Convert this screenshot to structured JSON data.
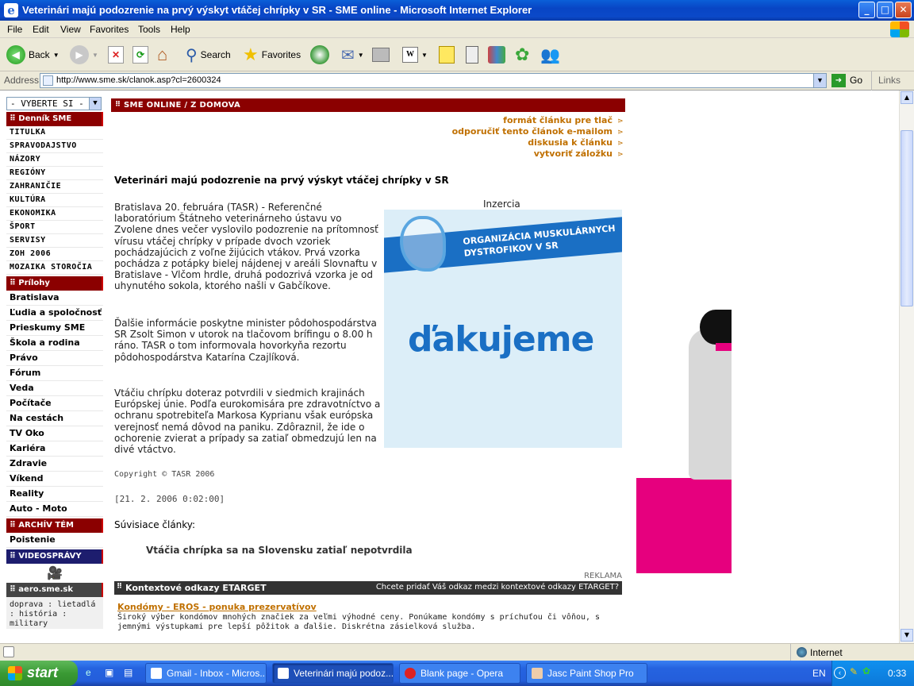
{
  "window": {
    "title": "Veterinári majú podozrenie na prvý výskyt vtáčej chrípky v SR - SME online - Microsoft Internet Explorer"
  },
  "menu": [
    "File",
    "Edit",
    "View",
    "Favorites",
    "Tools",
    "Help"
  ],
  "toolbar": {
    "back": "Back",
    "search": "Search",
    "favorites": "Favorites"
  },
  "address": {
    "label": "Address",
    "url": "http://www.sme.sk/clanok.asp?cl=2600324",
    "go": "Go",
    "links": "Links"
  },
  "nav": {
    "select": "- VYBERTE SI -",
    "sec1": "Denník SME",
    "items1": [
      "TITULKA",
      "SPRAVODAJSTVO",
      "NÁZORY",
      "REGIÓNY",
      "ZAHRANIČIE",
      "KULTÚRA",
      "EKONOMIKA",
      "ŠPORT",
      "SERVISY",
      "ZOH 2006",
      "MOZAIKA STOROČIA"
    ],
    "sec2": "Prílohy",
    "items2": [
      "Bratislava",
      "Ľudia a spoločnosť",
      "Prieskumy SME",
      "Škola a rodina",
      "Právo",
      "Fórum",
      "Veda",
      "Počítače",
      "Na cestách",
      "TV Oko",
      "Kariéra",
      "Zdravie",
      "Víkend",
      "Reality",
      "Auto - Moto"
    ],
    "sec3": "ARCHÍV TÉM",
    "item3": "Poistenie",
    "sec4": "VIDEOSPRÁVY",
    "sec5": "aero.sme.sk",
    "aero": "doprava : lietadlá : história : military"
  },
  "article": {
    "breadcrumb": "SME ONLINE / Z DOMOVA",
    "tools": [
      "formát článku pre tlač",
      "odporučiť tento článok e-mailom",
      "diskusia k článku",
      "vytvoriť záložku"
    ],
    "title": "Veterinári majú podozrenie na prvý výskyt vtáčej chrípky v SR",
    "p1": "Bratislava 20. februára (TASR) - Referenčné laboratórium Štátneho veterinárneho ústavu vo Zvolene dnes večer vyslovilo podozrenie na prítomnosť vírusu vtáčej chrípky v prípade dvoch vzoriek pochádzajúcich z voľne žijúcich vtákov. Prvá vzorka pochádza z potápky bielej nájdenej v areáli Slovnaftu v Bratislave - Vlčom hrdle, druhá podozrivá vzorka je od uhynutého sokola, ktorého našli v Gabčíkove.",
    "p2": "Ďalšie informácie poskytne minister pôdohospodárstva SR Zsolt Simon v utorok na tlačovom brífingu o 8.00 h ráno. TASR o tom informovala hovorkyňa rezortu pôdohospodárstva Katarína Czajlíková.",
    "p3": "Vtáčiu chrípku doteraz potvrdili v siedmich krajinách Európskej únie. Podľa eurokomisára pre zdravotníctvo a ochranu spotrebiteľa Markosa Kyprianu však európska verejnosť nemá dôvod na paniku. Zdôraznil, že ide o ochorenie zvierat a prípady sa zatiaľ obmedzujú len na divé vtáctvo.",
    "copyright": "Copyright © TASR 2006",
    "date": "[21. 2. 2006 0:02:00]",
    "related_label": "Súvisiace články:",
    "related": "Vtáčia chrípka sa na Slovensku zatiaľ nepotvrdila"
  },
  "ad": {
    "label": "Inzercia",
    "org": "ORGANIZÁCIA MUSKULÁRNYCH DYSTROFIKOV V SR",
    "thanks": "ďakujeme"
  },
  "etarget": {
    "reklama": "REKLAMA",
    "title": "Kontextové odkazy ETARGET",
    "cta": "Chcete pridať Váš odkaz medzi kontextové odkazy ETARGET?",
    "link": "Kondómy - EROS - ponuka prezervatívov",
    "desc": "Široký výber kondómov mnohých značiek za veľmi výhodné ceny. Ponúkame kondómy s príchuťou či vôňou, s jemnými výstupkami pre lepší pôžitok a ďalšie. Diskrétna zásielková služba."
  },
  "status": {
    "zone": "Internet"
  },
  "taskbar": {
    "start": "start",
    "tasks": [
      "Gmail - Inbox - Micros...",
      "Veterinári majú podoz...",
      "Blank page - Opera",
      "Jasc Paint Shop Pro"
    ],
    "lang": "EN",
    "time": "0:33"
  },
  "colors": {
    "sme_red": "#8b0000",
    "link_orange": "#c07000",
    "ad_blue": "#1a6fc4",
    "pink": "#e6007e"
  }
}
